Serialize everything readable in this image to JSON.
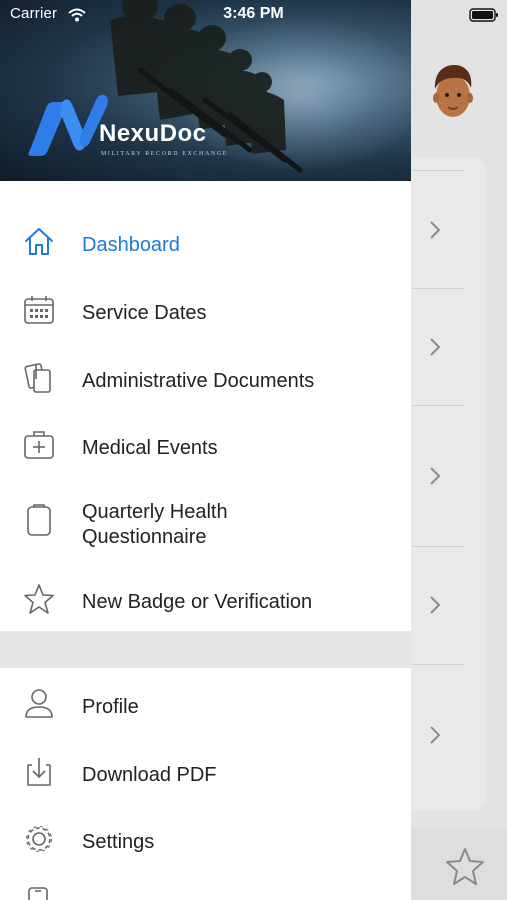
{
  "status_bar": {
    "carrier": "Carrier",
    "time": "3:46 PM"
  },
  "header": {
    "brand": "NexuDoc",
    "tagline": "MILITARY RECORD EXCHANGE"
  },
  "menu": {
    "items": [
      {
        "label": "Dashboard",
        "icon": "home-icon",
        "active": true
      },
      {
        "label": "Service Dates",
        "icon": "calendar-icon"
      },
      {
        "label": "Administrative Documents",
        "icon": "documents-icon"
      },
      {
        "label": "Medical Events",
        "icon": "medical-kit-icon"
      },
      {
        "label": "Quarterly Health\nQuestionnaire",
        "line1": "Quarterly Health",
        "line2": "Questionnaire",
        "icon": "clipboard-icon"
      },
      {
        "label": "New Badge or Verification",
        "icon": "star-icon"
      }
    ],
    "secondary": [
      {
        "label": "Profile",
        "icon": "person-icon"
      },
      {
        "label": "Download PDF",
        "icon": "download-icon"
      },
      {
        "label": "Settings",
        "icon": "gear-icon"
      }
    ]
  },
  "colors": {
    "accent": "#1b7bd9",
    "text": "#222222",
    "icon": "#666666"
  }
}
